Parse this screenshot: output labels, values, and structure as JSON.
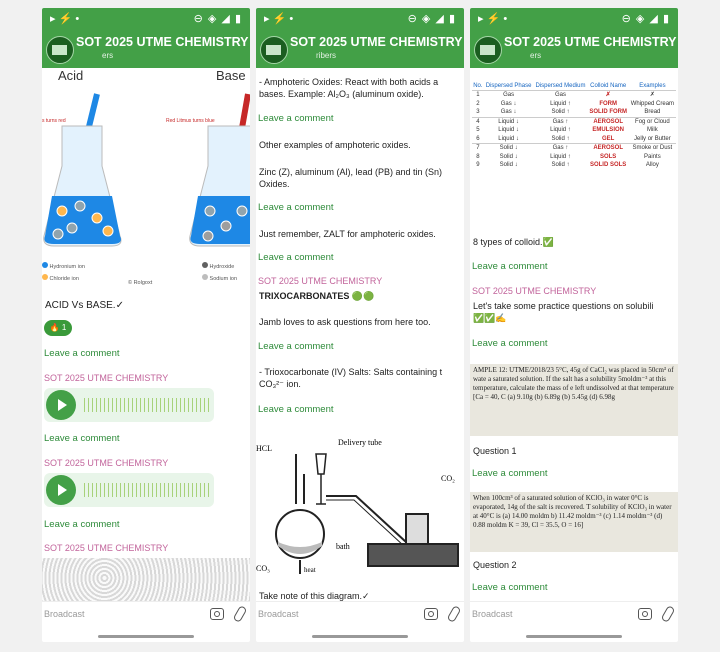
{
  "statusbar": {
    "left": "▸ ⚡ •",
    "right": "⊖ ◈ ◢ ▮"
  },
  "channel": {
    "title": "SOT 2025 UTME CHEMISTRY",
    "sub1": "ers",
    "sub2": "ribers",
    "sub3": "ers"
  },
  "input": {
    "placeholder": "Broadcast"
  },
  "common": {
    "leave_comment": "Leave a comment",
    "sender": "SOT 2025 UTME CHEMISTRY"
  },
  "p1": {
    "img_acid": "Acid",
    "img_base": "Base",
    "img_caption_left": "s turns red",
    "img_caption_right": "Red Litmus turns blue",
    "legend": [
      "Hydronium ion",
      "Chloride ion",
      "Hydroxide",
      "Sodium ion"
    ],
    "credit": "© Rolgoxt",
    "msg1": "ACID Vs BASE.✓",
    "reaction": "🔥 1"
  },
  "p2": {
    "msg_amphoteric": "- Amphoteric Oxides: React with both acids a bases. Example: Al₂O₃ (aluminum oxide).",
    "msg_other": "Other examples of amphoteric oxides.",
    "msg_zinc": "Zinc (Z), aluminum (Al), lead (PB) and tin (Sn) Oxides.",
    "msg_zalt": "Just remember, ZALT for amphoteric oxides.",
    "msg_trioxo_title": "TRIXOCARBONATES 🟢🟢",
    "msg_jamb": "Jamb loves to ask questions from here too.",
    "msg_salts": "- Trioxocarbonate (IV) Salts: Salts containing t CO₃²⁻ ion.",
    "diagram_labels": {
      "hcl": "HCL",
      "delivery": "Delivery tube",
      "co2": "CO₂",
      "bath": "bath",
      "heat": "heat",
      "caco3": "CO₃"
    },
    "msg_note": "Take note of this diagram.✓"
  },
  "p3": {
    "table_headers": [
      "No.",
      "Dispersed Phase",
      "Dispersed Medium",
      "Colloid Name",
      "Examples"
    ],
    "table_rows": [
      [
        "1",
        "Gas",
        "Gas",
        "✗",
        "✗"
      ],
      [
        "2",
        "Gas ↓",
        "Liquid ↑",
        "FORM",
        "Whipped Cream"
      ],
      [
        "3",
        "Gas ↓",
        "Solid ↑",
        "SOLID FORM",
        "Bread"
      ],
      [
        "4",
        "Liquid ↓",
        "Gas ↑",
        "AEROSOL",
        "Fog or Cloud"
      ],
      [
        "5",
        "Liquid ↓",
        "Liquid ↑",
        "EMULSION",
        "Milk"
      ],
      [
        "6",
        "Liquid ↓",
        "Solid ↑",
        "GEL",
        "Jelly or Butter"
      ],
      [
        "7",
        "Solid ↓",
        "Gas ↑",
        "AEROSOL",
        "Smoke or Dust"
      ],
      [
        "8",
        "Solid ↓",
        "Liquid ↑",
        "SOLS",
        "Paints"
      ],
      [
        "9",
        "Solid ↓",
        "Solid ↑",
        "SOLID SOLS",
        "Alloy"
      ]
    ],
    "msg_types": "8 types of colloid.✅",
    "msg_practice": "Let's take some practice questions on solubili ✅✅✍",
    "q1_text": "AMPLE 12: UTME/2018/23 5°C, 45g of CaCl₂ was placed in 50cm³ of wate a saturated solution. If the salt has a solubility 5moldm⁻³ at this temperature, calculate the mass of e left undissolved at that temperature [Ca = 40, C (a) 9.10g (b) 6.89g (b) 5.45g (d) 6.98g",
    "q1_label": "Question 1",
    "q2_text": "When 100cm³ of a saturated solution of KClO₃ in water 0°C is evaporated, 14g of the salt is recovered. T solubility of KClO₃ in water at 40°C is (a) 14.00 moldm b) 11.42 moldm⁻³ (c) 1.14 moldm⁻³ (d) 0.88 moldm K = 39, Cl = 35.5, O = 16]",
    "q2_label": "Question 2"
  }
}
